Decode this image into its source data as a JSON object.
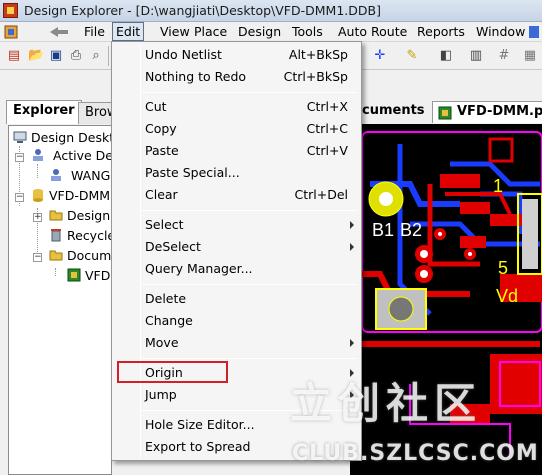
{
  "window": {
    "title": "Design Explorer - [D:\\wangjiati\\Desktop\\VFD-DMM1.DDB]"
  },
  "menubar": {
    "items": [
      "File",
      "Edit",
      "View",
      "Place",
      "Design",
      "Tools",
      "Auto Route",
      "Reports",
      "Window"
    ],
    "active": "Edit"
  },
  "explorer": {
    "tabs": [
      "Explorer",
      "Brow"
    ],
    "tree": [
      {
        "label": "Design Deskt",
        "icon": "desktop-icon"
      },
      {
        "label": "Active Des",
        "icon": "user-icon"
      },
      {
        "label": "WANG",
        "icon": "user-icon"
      },
      {
        "label": "VFD-DMM",
        "icon": "database-icon"
      },
      {
        "label": "Design",
        "icon": "folder-icon"
      },
      {
        "label": "Recycle",
        "icon": "recycle-bin-icon"
      },
      {
        "label": "Docum",
        "icon": "folder-icon"
      },
      {
        "label": "VFD",
        "icon": "pcb-document-icon"
      }
    ]
  },
  "document_tabs": [
    "cuments",
    "VFD-DMM.pcb"
  ],
  "edit_menu": {
    "items": [
      {
        "label": "Undo  Netlist",
        "shortcut": "Alt+BkSp"
      },
      {
        "label": "Nothing to Redo",
        "shortcut": "Ctrl+BkSp"
      },
      {
        "label": "Cut",
        "shortcut": "Ctrl+X"
      },
      {
        "label": "Copy",
        "shortcut": "Ctrl+C"
      },
      {
        "label": "Paste",
        "shortcut": "Ctrl+V"
      },
      {
        "label": "Paste Special...",
        "shortcut": ""
      },
      {
        "label": "Clear",
        "shortcut": "Ctrl+Del"
      },
      {
        "label": "Select",
        "shortcut": "",
        "submenu": true
      },
      {
        "label": "DeSelect",
        "shortcut": "",
        "submenu": true
      },
      {
        "label": "Query Manager...",
        "shortcut": ""
      },
      {
        "label": "Delete",
        "shortcut": ""
      },
      {
        "label": "Change",
        "shortcut": ""
      },
      {
        "label": "Move",
        "shortcut": "",
        "submenu": true
      },
      {
        "label": "Origin",
        "shortcut": "",
        "submenu": true,
        "highlighted": true
      },
      {
        "label": "Jump",
        "shortcut": "",
        "submenu": true
      },
      {
        "label": "Hole Size Editor...",
        "shortcut": ""
      },
      {
        "label": "Export to Spread",
        "shortcut": ""
      }
    ]
  },
  "pcb_labels": {
    "b1": "B1",
    "b2": "B2",
    "one": "1",
    "five": "5",
    "vd": "Vd"
  },
  "watermark": {
    "text": "立创社区",
    "url": "CLUB.SZLCSC.COM"
  },
  "colors": {
    "highlight_border": "#d2202a",
    "pcb_top_layer": "#e00000",
    "pcb_bottom_layer": "#1a3cff",
    "pcb_overlay": "#ffff00",
    "pcb_keepout": "#ff00ff"
  }
}
